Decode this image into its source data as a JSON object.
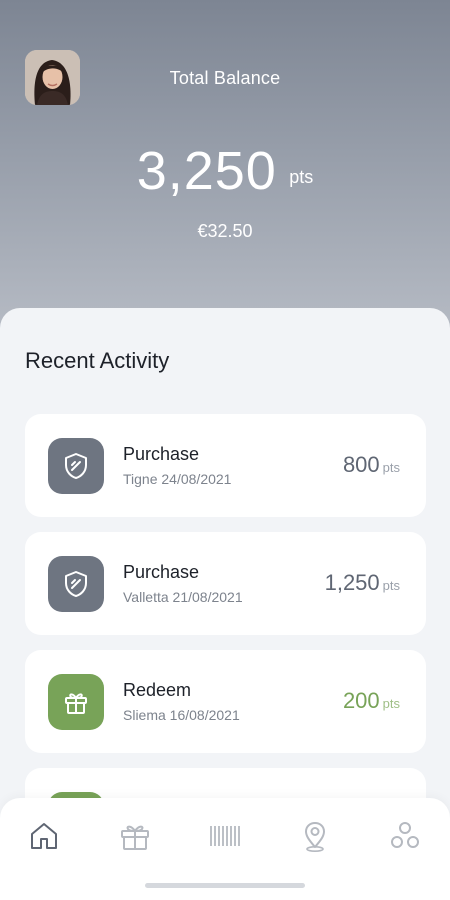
{
  "header": {
    "balance_label": "Total Balance",
    "balance_value": "3,250",
    "balance_unit": "pts",
    "balance_euro": "€32.50"
  },
  "activity": {
    "title": "Recent Activity",
    "items": [
      {
        "type": "Purchase",
        "location_date": "Tigne 24/08/2021",
        "points": "800",
        "unit": "pts",
        "icon": "shield-icon",
        "color": "#6e7581"
      },
      {
        "type": "Purchase",
        "location_date": "Valletta 21/08/2021",
        "points": "1,250",
        "unit": "pts",
        "icon": "shield-icon",
        "color": "#6e7581"
      },
      {
        "type": "Redeem",
        "location_date": "Sliema 16/08/2021",
        "points": "200",
        "unit": "pts",
        "icon": "gift-icon",
        "color": "#78a358"
      }
    ]
  },
  "nav": {
    "items": [
      {
        "icon": "home-icon",
        "active": true
      },
      {
        "icon": "gift-icon",
        "active": false
      },
      {
        "icon": "barcode-icon",
        "active": false
      },
      {
        "icon": "location-pin-icon",
        "active": false
      },
      {
        "icon": "circles-icon",
        "active": false
      }
    ]
  },
  "colors": {
    "accent_green": "#78a358",
    "tile_gray": "#6e7581",
    "nav_active": "#5f6673",
    "nav_inactive": "#b5b9c0"
  }
}
